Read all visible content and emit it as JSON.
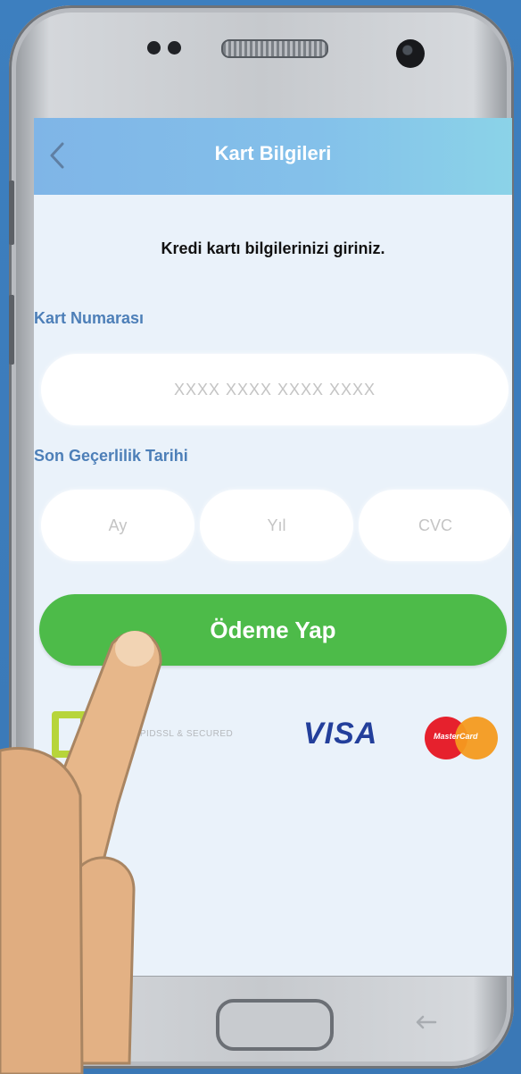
{
  "header": {
    "title": "Kart Bilgileri"
  },
  "form": {
    "instruction": "Kredi kartı bilgilerinizi giriniz.",
    "card_number_label": "Kart Numarası",
    "card_number_placeholder": "XXXX XXXX XXXX XXXX",
    "expiry_label": "Son Geçerlilik Tarihi",
    "month_placeholder": "Ay",
    "year_placeholder": "Yıl",
    "cvc_placeholder": "CVC"
  },
  "actions": {
    "pay_label": "Ödeme Yap"
  },
  "badges": {
    "secure_text": "RAPIDSSL & SECURED",
    "visa": "VISA",
    "mastercard": "MasterCard"
  },
  "colors": {
    "header_start": "#7fb5e7",
    "header_end": "#8bd3e8",
    "primary_button": "#4dbb49",
    "label_blue": "#4d7fb8",
    "screen_bg": "#eaf2fa"
  },
  "icons": {
    "back": "chevron-left-icon",
    "home": "home-button",
    "recent_apps": "back-arrow-icon"
  }
}
